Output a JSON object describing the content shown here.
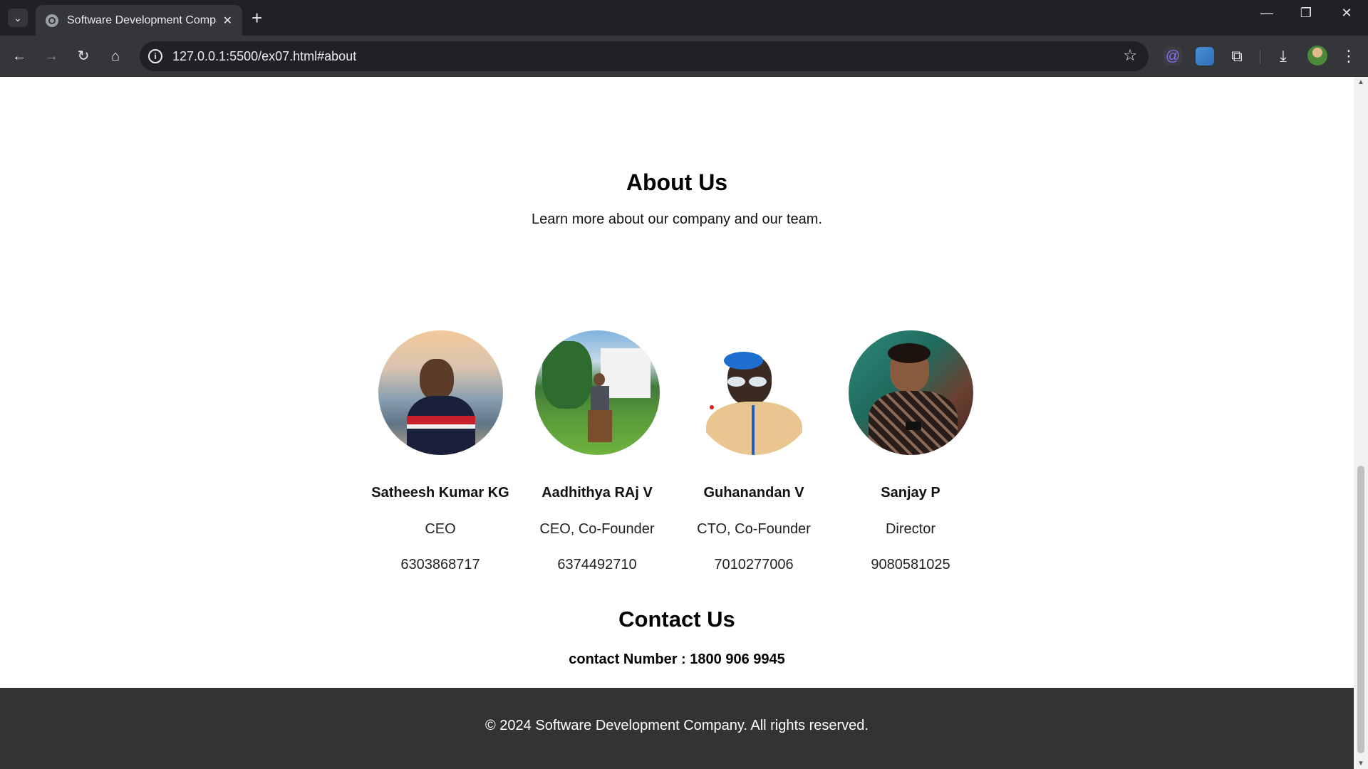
{
  "browser": {
    "tab_title": "Software Development Compar",
    "tab_close": "✕",
    "tab_menu_icon": "chevron-down-icon",
    "new_tab_icon": "+",
    "url": "127.0.0.1:5500/ex07.html#about",
    "window_controls": {
      "minimize": "—",
      "restore": "❐",
      "close": "✕"
    },
    "nav": {
      "back": "←",
      "forward": "→",
      "reload": "↻",
      "home": "⌂"
    },
    "star": "☆",
    "download": "⤓",
    "menu": "⋮",
    "extension_puzzle": "⧉"
  },
  "about": {
    "title": "About Us",
    "subtitle": "Learn more about our company and our team."
  },
  "team": [
    {
      "name": "Satheesh Kumar KG",
      "role": "CEO",
      "phone": "6303868717"
    },
    {
      "name": "Aadhithya RAj V",
      "role": "CEO, Co-Founder",
      "phone": "6374492710"
    },
    {
      "name": "Guhanandan V",
      "role": "CTO, Co-Founder",
      "phone": "7010277006"
    },
    {
      "name": "Sanjay P",
      "role": "Director",
      "phone": "9080581025"
    }
  ],
  "contact": {
    "title": "Contact Us",
    "number": "contact Number : 1800 906 9945"
  },
  "footer": {
    "text": "© 2024 Software Development Company. All rights reserved."
  },
  "colors": {
    "footer_bg": "#333333",
    "chrome_dark": "#202124",
    "chrome_toolbar": "#35363a"
  }
}
